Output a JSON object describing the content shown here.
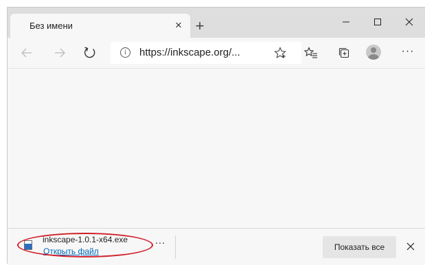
{
  "tab": {
    "title": "Без имени",
    "close_glyph": "×",
    "new_tab_glyph": "+"
  },
  "window_controls": {
    "minimize": "minimize-icon",
    "maximize": "maximize-icon",
    "close": "close-icon"
  },
  "toolbar": {
    "back": "back-arrow-icon",
    "forward": "forward-arrow-icon",
    "refresh": "refresh-icon",
    "url": "https://inkscape.org/...",
    "info_glyph": "i",
    "favorite": "star-icon",
    "favorites_list": "favorites-icon",
    "collections": "collections-icon",
    "profile": "profile-avatar",
    "more_glyph": "···"
  },
  "download": {
    "file_name": "inkscape-1.0.1-x64.exe",
    "open_file_label": "Открыть файл",
    "more_glyph": "···",
    "show_all_label": "Показать все",
    "highlight_color": "#d0202a",
    "link_color": "#0067b8"
  }
}
